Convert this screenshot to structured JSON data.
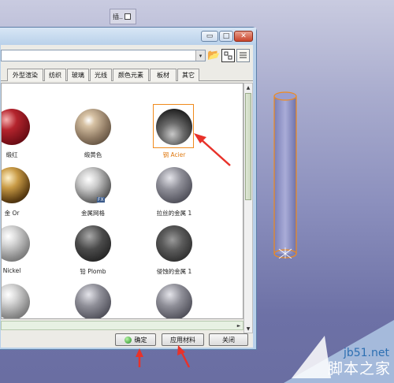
{
  "mini_tab": {
    "label": "插.."
  },
  "window": {
    "buttons": {
      "minimize": "▭",
      "maximize": "□",
      "close": "✕"
    }
  },
  "toolbar": {
    "dropdown_arrow": "▾",
    "icons": [
      "folder-open-icon",
      "large-icons-view-icon",
      "details-view-icon"
    ]
  },
  "tabs": [
    "外型渲染",
    "纺织",
    "玻璃",
    "光线",
    "颜色元素",
    "板材",
    "其它"
  ],
  "materials": [
    {
      "label": "缎红",
      "icon": "red-metal-sphere"
    },
    {
      "label": "缎黄色",
      "icon": "bronze-sphere"
    },
    {
      "label": "钢 Acier",
      "icon": "steel-sphere",
      "selected": true
    },
    {
      "label": "金 Or",
      "icon": "gold-sphere"
    },
    {
      "label": "金属网格",
      "icon": "mesh-sphere",
      "badge": "FX"
    },
    {
      "label": "拉丝的金属 1",
      "icon": "brushed-metal-sphere"
    },
    {
      "label": "Nickel",
      "icon": "nickel-sphere"
    },
    {
      "label": "铅 Plomb",
      "icon": "lead-sphere"
    },
    {
      "label": "侵蚀的金属 1",
      "icon": "corroded-metal-sphere"
    }
  ],
  "scroll_arrows": {
    "up": "▲",
    "down": "▼",
    "right": "►"
  },
  "buttons": {
    "ok": "确定",
    "apply": "应用材料",
    "close": "关闭"
  },
  "watermark": {
    "url": "jb51.net",
    "name": "脚本之家"
  },
  "colors": {
    "selection": "#f08a1c",
    "annotation_arrow": "#e8322a"
  }
}
